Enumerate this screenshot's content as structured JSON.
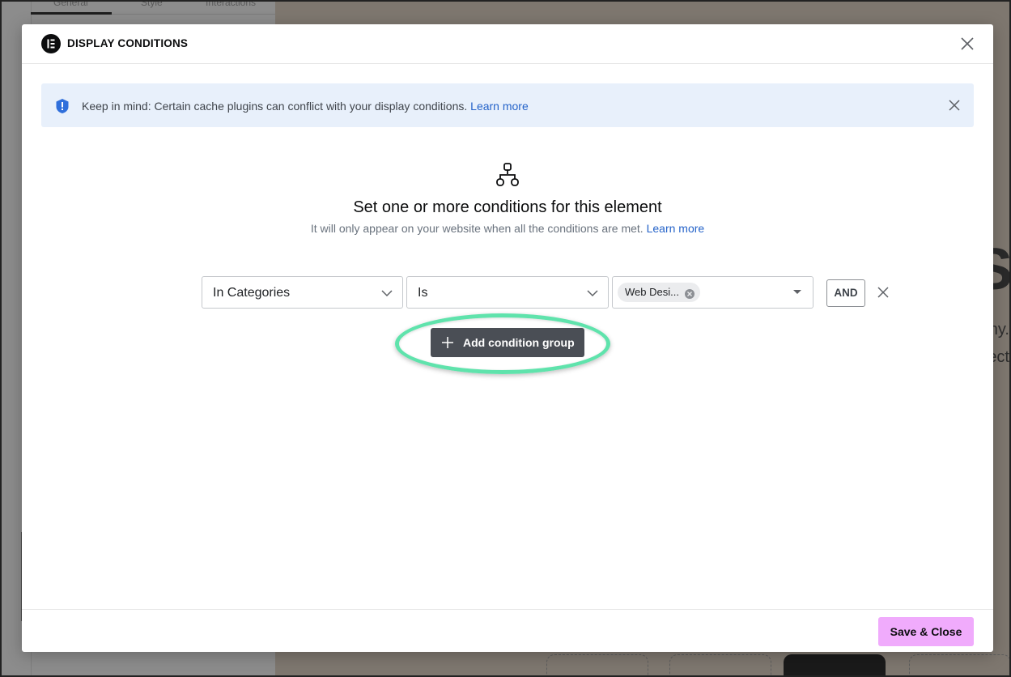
{
  "background": {
    "tabs": [
      "General",
      "Style",
      "Interactions"
    ],
    "big_letter": "S",
    "fragments": [
      "ny.",
      "ect"
    ]
  },
  "modal": {
    "title": "DISPLAY CONDITIONS",
    "logo_icon": "elementor-logo-icon",
    "close_icon": "close-icon"
  },
  "notice": {
    "icon": "info-shield-icon",
    "text": "Keep in mind: Certain cache plugins can conflict with your display conditions.",
    "link": "Learn more",
    "close_icon": "close-icon"
  },
  "hero": {
    "icon": "sitemap-icon",
    "title": "Set one or more conditions for this element",
    "subtitle": "It will only appear on your website when all the conditions are met.",
    "link": "Learn more"
  },
  "condition": {
    "field": "In Categories",
    "operator": "Is",
    "value_chip": "Web Desi...",
    "and_label": "AND"
  },
  "actions": {
    "add_group": "Add condition group",
    "save_close": "Save & Close"
  },
  "colors": {
    "accent_link": "#2563c9",
    "notice_bg": "#e8f0fb",
    "save_bg": "#f0abfc",
    "add_btn_bg": "#4a4e55",
    "highlight": "#5fe3ac"
  }
}
